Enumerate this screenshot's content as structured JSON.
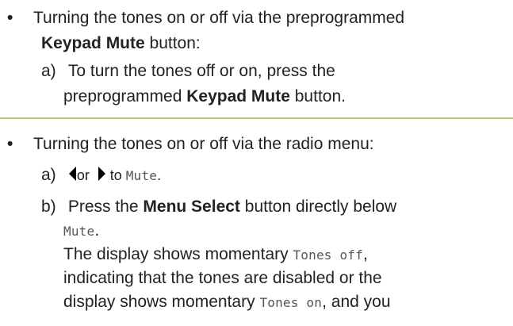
{
  "section1": {
    "bullet": "•",
    "line1": "Turning the tones on or off via the preprogrammed",
    "line2_bold": "Keypad Mute",
    "line2_rest": " button:",
    "step_a_label": "a)",
    "step_a_line1": "To turn the tones off or on, press the",
    "step_a_line2_pre": "preprogrammed ",
    "step_a_line2_bold": "Keypad Mute",
    "step_a_line2_post": " button."
  },
  "section2": {
    "bullet": "•",
    "line1": "Turning the tones on or off via the radio menu:",
    "step_a_label": "a)",
    "step_a_or": "or",
    "step_a_to": " to ",
    "step_a_mono": "Mute",
    "step_a_end": ".",
    "step_b_label": "b)",
    "step_b_pre": "Press the ",
    "step_b_bold": "Menu Select",
    "step_b_post": " button directly below",
    "step_b_line2_mono": "Mute",
    "step_b_line2_end": ".",
    "step_b_p1_pre": "The display shows momentary ",
    "step_b_p1_mono": "Tones off",
    "step_b_p1_end": ",",
    "step_b_p2": "indicating that the tones are disabled or the",
    "step_b_p3_pre": "display shows momentary ",
    "step_b_p3_mono": "Tones on",
    "step_b_p3_end": ", and you"
  },
  "colors": {
    "divider": "#b4cc7a",
    "text": "#222222",
    "mono": "#555555"
  },
  "icons": {
    "left": "left-arrow-icon",
    "right": "right-arrow-icon"
  }
}
